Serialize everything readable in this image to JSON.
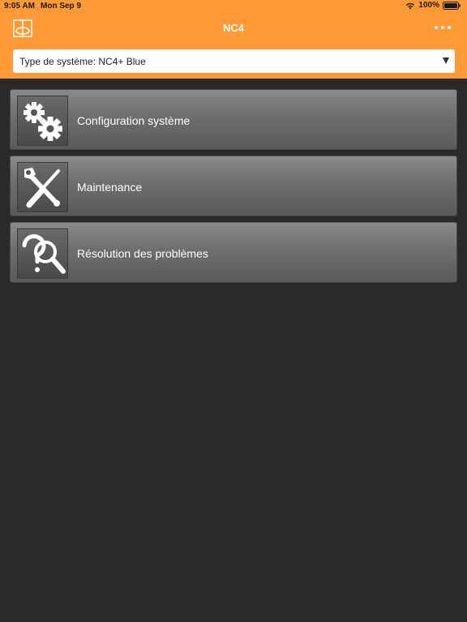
{
  "status": {
    "time": "9:05 AM",
    "date": "Mon Sep 9",
    "battery": "100%"
  },
  "nav": {
    "title": "NC4"
  },
  "system_select": {
    "label": "Type de système: NC4+ Blue"
  },
  "menu": {
    "items": [
      {
        "label": "Configuration système",
        "icon": "gears-icon"
      },
      {
        "label": "Maintenance",
        "icon": "wrench-screwdriver-icon"
      },
      {
        "label": "Résolution des problèmes",
        "icon": "question-magnifier-icon"
      }
    ]
  },
  "colors": {
    "header": "#fd9a35",
    "background": "#2a2a2a"
  }
}
